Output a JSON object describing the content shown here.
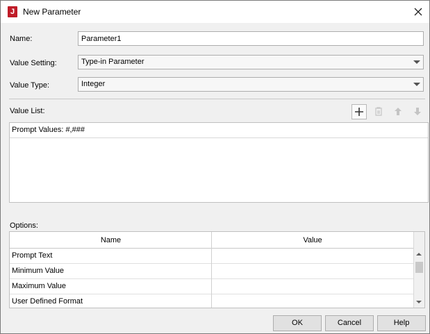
{
  "dialog": {
    "title": "New Parameter",
    "app_icon_letter": "J"
  },
  "form": {
    "name_label": "Name:",
    "name_value": "Parameter1",
    "value_setting_label": "Value Setting:",
    "value_setting_value": "Type-in Parameter",
    "value_type_label": "Value Type:",
    "value_type_value": "Integer"
  },
  "value_list": {
    "label": "Value List:",
    "items": [
      "Prompt Values: #,###"
    ],
    "toolbar": [
      "add-icon",
      "delete-icon",
      "move-up-icon",
      "move-down-icon"
    ]
  },
  "options": {
    "label": "Options:",
    "columns": [
      "Name",
      "Value"
    ],
    "rows": [
      {
        "name": "Prompt Text",
        "value": ""
      },
      {
        "name": "Minimum Value",
        "value": ""
      },
      {
        "name": "Maximum Value",
        "value": ""
      },
      {
        "name": "User Defined Format",
        "value": ""
      }
    ]
  },
  "buttons": {
    "ok": "OK",
    "cancel": "Cancel",
    "help": "Help"
  },
  "colors": {
    "accent": "#c01c28",
    "dialog_bg": "#f0f0f0",
    "field_border": "#adadad"
  }
}
